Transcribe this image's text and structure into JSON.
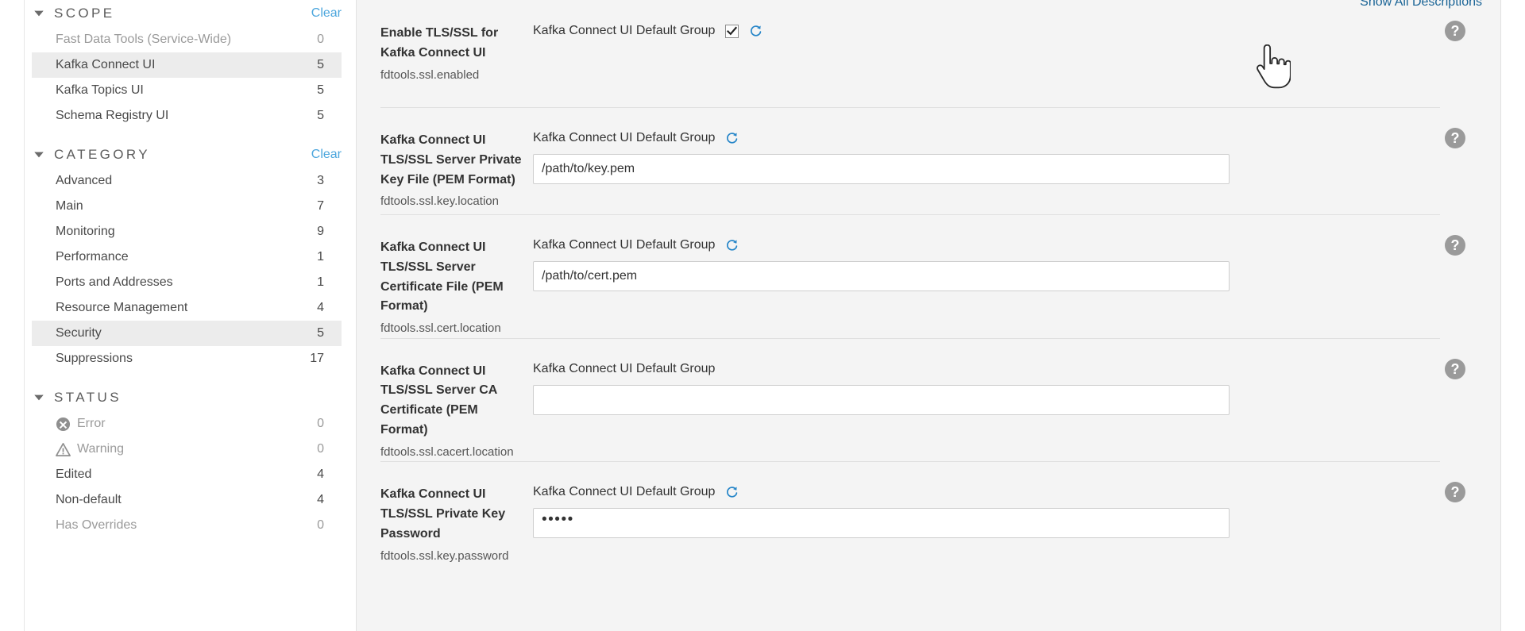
{
  "sidebar": {
    "groups": [
      {
        "title": "SCOPE",
        "clear_label": "Clear",
        "chevron_icon": "chevron-down-icon",
        "items": [
          {
            "label": "Fast Data Tools (Service-Wide)",
            "count": "0",
            "muted": true,
            "selected": false,
            "icon": null
          },
          {
            "label": "Kafka Connect UI",
            "count": "5",
            "muted": false,
            "selected": true,
            "icon": null
          },
          {
            "label": "Kafka Topics UI",
            "count": "5",
            "muted": false,
            "selected": false,
            "icon": null
          },
          {
            "label": "Schema Registry UI",
            "count": "5",
            "muted": false,
            "selected": false,
            "icon": null
          }
        ]
      },
      {
        "title": "CATEGORY",
        "clear_label": "Clear",
        "chevron_icon": "chevron-down-icon",
        "items": [
          {
            "label": "Advanced",
            "count": "3",
            "muted": false,
            "selected": false,
            "icon": null
          },
          {
            "label": "Main",
            "count": "7",
            "muted": false,
            "selected": false,
            "icon": null
          },
          {
            "label": "Monitoring",
            "count": "9",
            "muted": false,
            "selected": false,
            "icon": null
          },
          {
            "label": "Performance",
            "count": "1",
            "muted": false,
            "selected": false,
            "icon": null
          },
          {
            "label": "Ports and Addresses",
            "count": "1",
            "muted": false,
            "selected": false,
            "icon": null
          },
          {
            "label": "Resource Management",
            "count": "4",
            "muted": false,
            "selected": false,
            "icon": null
          },
          {
            "label": "Security",
            "count": "5",
            "muted": false,
            "selected": true,
            "icon": null
          },
          {
            "label": "Suppressions",
            "count": "17",
            "muted": false,
            "selected": false,
            "icon": null
          }
        ]
      },
      {
        "title": "STATUS",
        "clear_label": "",
        "chevron_icon": "chevron-down-icon",
        "items": [
          {
            "label": "Error",
            "count": "0",
            "muted": true,
            "selected": false,
            "icon": "error-icon"
          },
          {
            "label": "Warning",
            "count": "0",
            "muted": true,
            "selected": false,
            "icon": "warning-icon"
          },
          {
            "label": "Edited",
            "count": "4",
            "muted": false,
            "selected": false,
            "icon": null
          },
          {
            "label": "Non-default",
            "count": "4",
            "muted": false,
            "selected": false,
            "icon": null
          },
          {
            "label": "Has Overrides",
            "count": "0",
            "muted": true,
            "selected": false,
            "icon": null
          }
        ]
      }
    ]
  },
  "content": {
    "show_all_descriptions": "Show All Descriptions",
    "help_icon_glyph": "?",
    "reset_icon": "reset-circular-arrow-icon",
    "rows": [
      {
        "name": "Enable TLS/SSL for Kafka Connect UI",
        "property": "fdtools.ssl.enabled",
        "group": "Kafka Connect UI Default Group",
        "control": "checkbox",
        "checked": true,
        "show_reset": true,
        "value": "",
        "placeholder": ""
      },
      {
        "name": "Kafka Connect UI TLS/SSL Server Private Key File (PEM Format)",
        "property": "fdtools.ssl.key.location",
        "group": "Kafka Connect UI Default Group",
        "control": "text",
        "checked": false,
        "show_reset": true,
        "value": "/path/to/key.pem",
        "placeholder": ""
      },
      {
        "name": "Kafka Connect UI TLS/SSL Server Certificate File (PEM Format)",
        "property": "fdtools.ssl.cert.location",
        "group": "Kafka Connect UI Default Group",
        "control": "text",
        "checked": false,
        "show_reset": true,
        "value": "/path/to/cert.pem",
        "placeholder": ""
      },
      {
        "name": "Kafka Connect UI TLS/SSL Server CA Certificate (PEM Format)",
        "property": "fdtools.ssl.cacert.location",
        "group": "Kafka Connect UI Default Group",
        "control": "text",
        "checked": false,
        "show_reset": false,
        "value": "",
        "placeholder": ""
      },
      {
        "name": "Kafka Connect UI TLS/SSL Private Key Password",
        "property": "fdtools.ssl.key.password",
        "group": "Kafka Connect UI Default Group",
        "control": "password",
        "checked": false,
        "show_reset": true,
        "value": "•••••",
        "placeholder": ""
      }
    ]
  },
  "cursor": {
    "icon": "hand-pointer-cursor"
  },
  "colors": {
    "accent_link": "#4ca6dd",
    "description_link": "#1a6496",
    "reset_blue": "#2585c8",
    "panel_bg": "#f4f4f4",
    "selected_row_bg": "#ececec",
    "help_gray": "#9a9a9a"
  }
}
